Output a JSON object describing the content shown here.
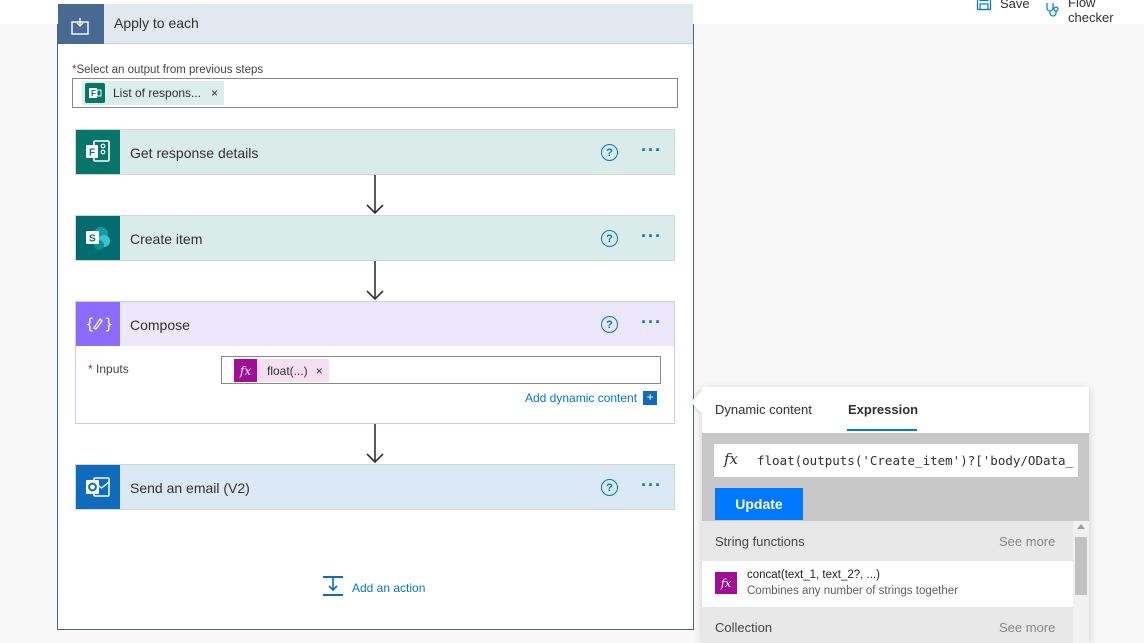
{
  "toolbar": {
    "save_label": "Save",
    "flow_checker_label": "Flow checker"
  },
  "apply_to_each": {
    "title": "Apply to each",
    "select_label_required": "*",
    "select_label": "Select an output from previous steps",
    "token_label": "List of respons...",
    "token_remove": "×"
  },
  "actions": [
    {
      "title": "Get response details",
      "help": "?",
      "more": "···"
    },
    {
      "title": "Create item",
      "help": "?",
      "more": "···"
    },
    {
      "title": "Compose",
      "help": "?",
      "more": "···"
    },
    {
      "title": "Send an email (V2)",
      "help": "?",
      "more": "···"
    }
  ],
  "compose": {
    "inputs_required": "*",
    "inputs_label": "Inputs",
    "token_icon": "fx",
    "token_label": "float(...)",
    "token_remove": "×",
    "add_dynamic_content": "Add dynamic content",
    "add_dynamic_plus": "+"
  },
  "add_action_label": "Add an action",
  "panel": {
    "tab_dynamic": "Dynamic content",
    "tab_expression": "Expression",
    "expression_icon": "fx",
    "expression_value": "float(outputs('Create_item')?['body/OData_",
    "update_label": "Update",
    "sections": [
      {
        "title": "String functions",
        "see_more": "See more"
      },
      {
        "title": "Collection",
        "see_more": "See more"
      }
    ],
    "functions": [
      {
        "icon": "fx",
        "name": "concat(text_1, text_2?, ...)",
        "description": "Combines any number of strings together"
      }
    ]
  },
  "colors": {
    "accent": "#0078d4",
    "update_button": "#0078ff",
    "expression_token": "#a00e95",
    "forms_brand": "#077568",
    "sharepoint_brand": "#036c70",
    "compose_brand": "#8c6cff",
    "outlook_brand": "#0f6cbd"
  }
}
